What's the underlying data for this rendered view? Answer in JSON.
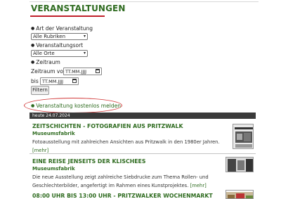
{
  "header": {
    "title": "VERANSTALTUNGEN"
  },
  "filters": {
    "art_label": "Art der Veranstaltung",
    "art_value": "Alle Rubriken",
    "ort_label": "Veranstaltungsort",
    "ort_value": "Alle Orte",
    "zeitraum_label": "Zeitraum",
    "von_label": "Zeitraum von",
    "von_placeholder": "TT.MM.JJJJ",
    "bis_label": "bis",
    "bis_placeholder": "TT.MM.JJJJ",
    "filter_button": "Filtern"
  },
  "meld_link": "Veranstaltung kostenlos melden",
  "list_header": "heute 24.07.2024",
  "events": [
    {
      "title": "ZEITSCHICHTEN - FOTOGRAFIEN AUS PRITZWALK",
      "place": "Museumsfabrik",
      "desc": "Fotoausstellung mit zahlreichen Ansichten aus Pritzwalk in den 1980er Jahren.",
      "more": "[mehr]"
    },
    {
      "title": "EINE REISE JENSEITS DER KLISCHEES",
      "place": "Museumsfabrik",
      "desc": "Die neue Ausstellung zeigt zahlreiche Siebdrucke zum Thema Rollen- und Geschlechterbilder, angefertigt im Rahmen eines Kunstprojektes.",
      "more": "[mehr]"
    },
    {
      "title": "08:00 UHR BIS 13:00 UHR - PRITZWALKER WOCHENMARKT"
    }
  ],
  "colors": {
    "accent_green": "#2e6b1f",
    "accent_red": "#c0202a",
    "annotation_red": "#d23a3a"
  }
}
